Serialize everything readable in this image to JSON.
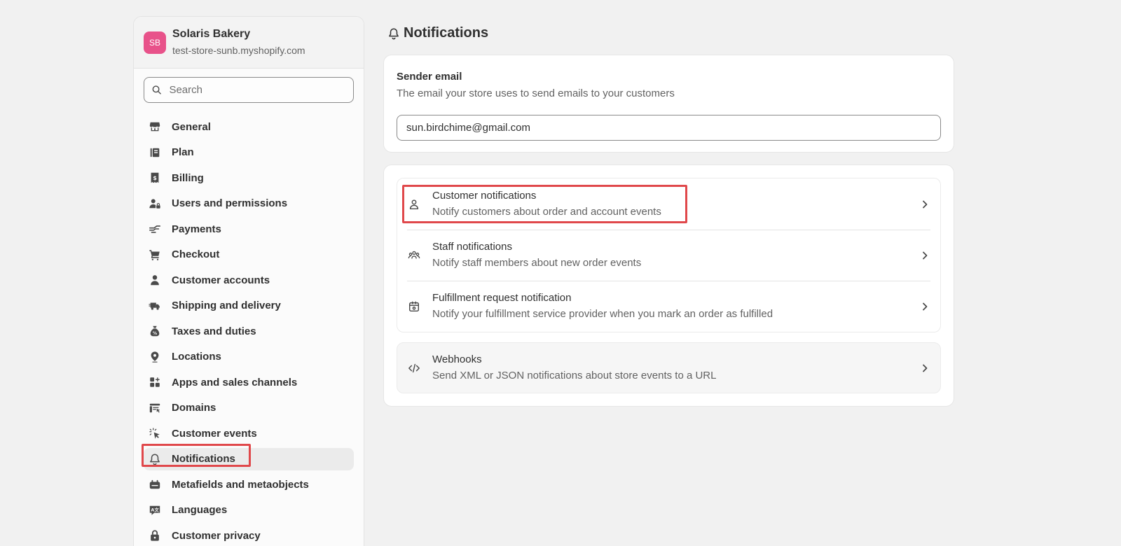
{
  "store": {
    "initials": "SB",
    "name": "Solaris Bakery",
    "domain": "test-store-sunb.myshopify.com"
  },
  "search": {
    "placeholder": "Search"
  },
  "sidebar": {
    "items": [
      {
        "label": "General",
        "icon": "store-icon"
      },
      {
        "label": "Plan",
        "icon": "plan-icon"
      },
      {
        "label": "Billing",
        "icon": "billing-icon"
      },
      {
        "label": "Users and permissions",
        "icon": "users-icon"
      },
      {
        "label": "Payments",
        "icon": "payments-icon"
      },
      {
        "label": "Checkout",
        "icon": "cart-icon"
      },
      {
        "label": "Customer accounts",
        "icon": "person-icon"
      },
      {
        "label": "Shipping and delivery",
        "icon": "truck-icon"
      },
      {
        "label": "Taxes and duties",
        "icon": "tax-icon"
      },
      {
        "label": "Locations",
        "icon": "location-icon"
      },
      {
        "label": "Apps and sales channels",
        "icon": "apps-icon"
      },
      {
        "label": "Domains",
        "icon": "domains-icon"
      },
      {
        "label": "Customer events",
        "icon": "cursor-click-icon"
      },
      {
        "label": "Notifications",
        "icon": "bell-icon",
        "active": true
      },
      {
        "label": "Metafields and metaobjects",
        "icon": "metafields-icon"
      },
      {
        "label": "Languages",
        "icon": "languages-icon"
      },
      {
        "label": "Customer privacy",
        "icon": "lock-icon"
      }
    ]
  },
  "page": {
    "title": "Notifications"
  },
  "sender": {
    "title": "Sender email",
    "description": "The email your store uses to send emails to your customers",
    "value": "sun.birdchime@gmail.com"
  },
  "notifications": [
    {
      "title": "Customer notifications",
      "description": "Notify customers about order and account events",
      "icon": "person-outline-icon"
    },
    {
      "title": "Staff notifications",
      "description": "Notify staff members about new order events",
      "icon": "group-icon"
    },
    {
      "title": "Fulfillment request notification",
      "description": "Notify your fulfillment service provider when you mark an order as fulfilled",
      "icon": "package-icon"
    }
  ],
  "webhooks": {
    "title": "Webhooks",
    "description": "Send XML or JSON notifications about store events to a URL",
    "icon": "code-icon"
  },
  "colors": {
    "highlight": "#e0484b",
    "avatar": "#e8528a"
  }
}
